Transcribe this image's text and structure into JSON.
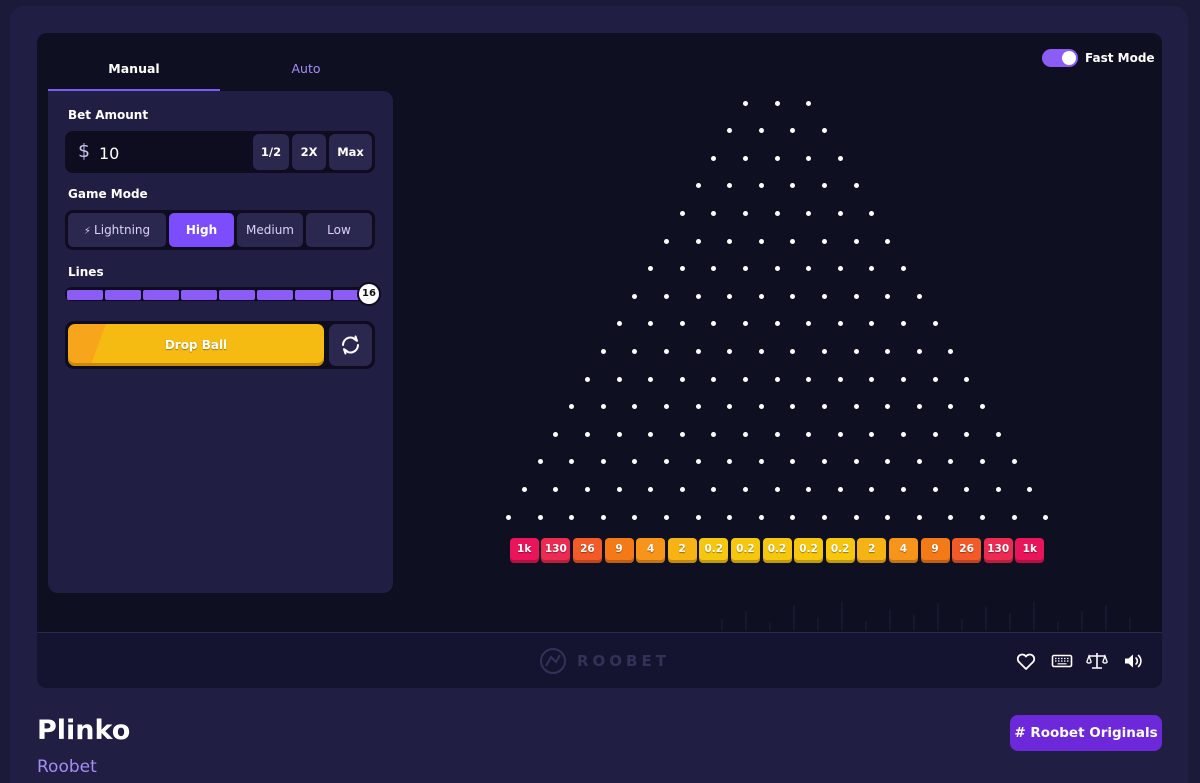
{
  "tabs": {
    "manual": "Manual",
    "auto": "Auto"
  },
  "bet": {
    "label": "Bet Amount",
    "currency_symbol": "$",
    "value": "10",
    "half_label": "1/2",
    "double_label": "2X",
    "max_label": "Max"
  },
  "game_mode": {
    "label": "Game Mode",
    "options": [
      "Lightning",
      "High",
      "Medium",
      "Low"
    ],
    "selected": "High"
  },
  "lines": {
    "label": "Lines",
    "value": "16"
  },
  "drop_ball_label": "Drop Ball",
  "fast_mode": {
    "label": "Fast Mode",
    "on": true
  },
  "multipliers": [
    "1k",
    "130",
    "26",
    "9",
    "4",
    "2",
    "0.2",
    "0.2",
    "0.2",
    "0.2",
    "0.2",
    "2",
    "4",
    "9",
    "26",
    "130",
    "1k"
  ],
  "bucket_colors": [
    "#e9145a",
    "#ec2a52",
    "#f25a28",
    "#f47a17",
    "#f6951a",
    "#f6b313",
    "#f7c70e",
    "#f7c70e",
    "#f7c70e",
    "#f7c70e",
    "#f7c70e",
    "#f6b313",
    "#f6951a",
    "#f47a17",
    "#f25a28",
    "#ec2a52",
    "#e9145a"
  ],
  "brand_watermark": "ROOBET",
  "footer_icons": [
    "heart-icon",
    "keyboard-icon",
    "scale-icon",
    "speaker-icon"
  ],
  "game": {
    "title": "Plinko",
    "provider": "Roobet"
  },
  "tag_label": "# Roobet Originals",
  "colors": {
    "accent": "#8b5cf6",
    "background": "#1b1a38",
    "board": "#0f0f22",
    "drop_button": "#f5bb12"
  }
}
